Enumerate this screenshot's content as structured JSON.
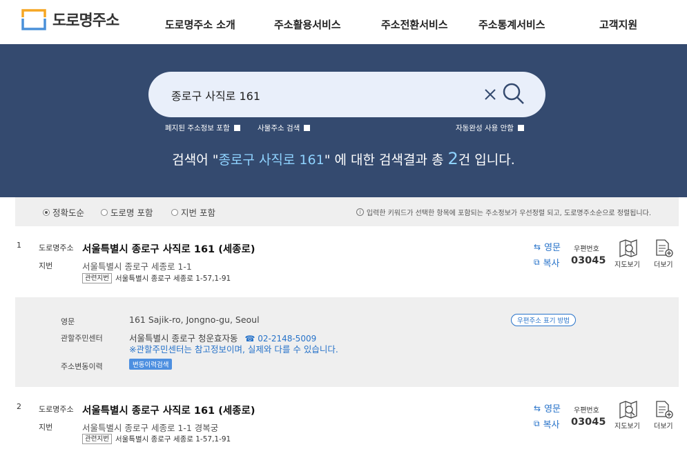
{
  "header": {
    "logo_text": "도로명주소",
    "nav": [
      "도로명주소 소개",
      "주소활용서비스",
      "주소전환서비스",
      "주소통계서비스",
      "고객지원"
    ]
  },
  "search": {
    "query": "종로구 사직로 161",
    "options": {
      "abolished": "폐지된 주소정보 포함",
      "object": "사물주소 검색",
      "autocomplete_off": "자동완성 사용 안함"
    }
  },
  "result_summary": {
    "prefix": "검색어 \"",
    "keyword": "종로구 사직로 161",
    "middle": "\" 에 대한 검색결과 총 ",
    "count": "2",
    "suffix": "건 입니다."
  },
  "filter": {
    "options": [
      "정확도순",
      "도로명 포함",
      "지번 포함"
    ],
    "selected": "정확도순",
    "info": "입력한 키워드가 선택한 항목에 포함되는 주소정보가 우선정렬 되고, 도로명주소순으로 정렬됩니다."
  },
  "labels": {
    "road": "도로명주소",
    "jibun": "지번",
    "related": "관련지번",
    "english": "영문",
    "copy": "복사",
    "postal_label": "우편번호",
    "map": "지도보기",
    "more": "더보기"
  },
  "results": [
    {
      "num": "1",
      "road": "서울특별시 종로구 사직로 161 (세종로)",
      "jibun": "서울특별시 종로구 세종로 1-1",
      "related": "서울특별시 종로구 세종로 1-57,1-91",
      "postal": "03045"
    },
    {
      "num": "2",
      "road": "서울특별시 종로구 사직로 161 (세종로)",
      "jibun": "서울특별시 종로구 세종로 1-1 경복궁",
      "related": "서울특별시 종로구 세종로 1-57,1-91",
      "postal": "03045"
    }
  ],
  "detail": {
    "english_label": "영문",
    "english_value": "161 Sajik-ro, Jongno-gu, Seoul",
    "center_label": "관할주민센터",
    "center_value": "서울특별시 종로구 청운효자동",
    "center_phone": "☎ 02-2148-5009",
    "center_note": "※관할주민센터는 참고정보이며, 실제와 다를 수 있습니다.",
    "history_label": "주소변동이력",
    "history_button": "변동이력검색",
    "postal_format_button": "우편주소 표기 방법"
  },
  "colors": {
    "hero_bg": "#344a6f",
    "accent": "#2672c9",
    "logo_blue": "#4a90d9",
    "logo_orange": "#f5a623"
  }
}
